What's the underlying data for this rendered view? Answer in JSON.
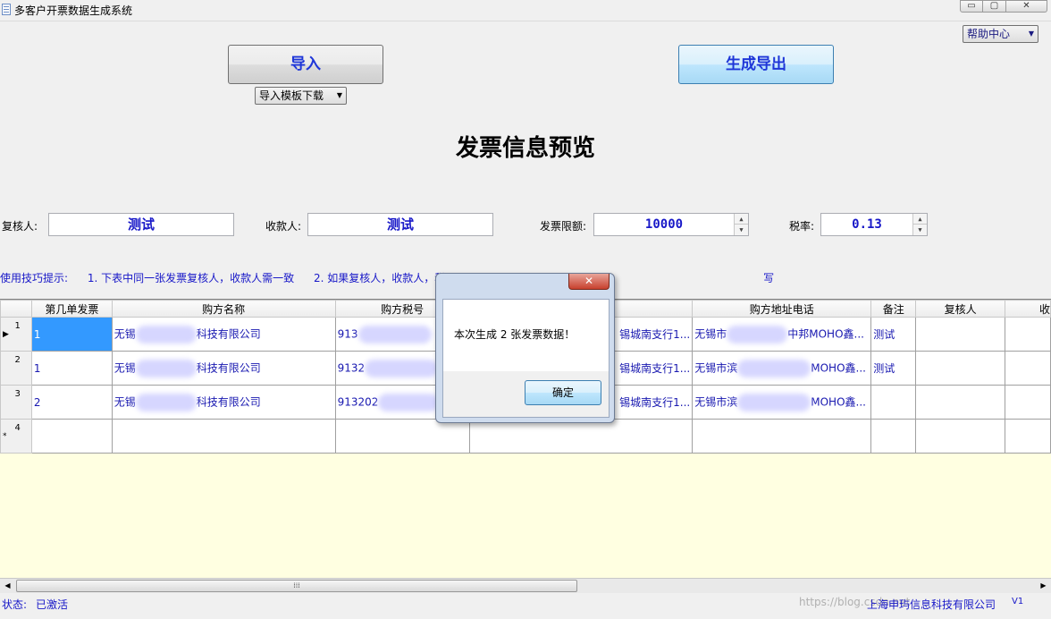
{
  "window": {
    "title": "多客户开票数据生成系统",
    "controls": {
      "minimize": "▭",
      "maximize": "▢",
      "close": "✕"
    }
  },
  "toolbar": {
    "import_label": "导入",
    "export_label": "生成导出",
    "template_dropdown": "导入模板下载",
    "help_dropdown": "帮助中心"
  },
  "preview_title": "发票信息预览",
  "fields": {
    "reviewer": {
      "label": "复核人:",
      "value": "测试"
    },
    "payee": {
      "label": "收款人:",
      "value": "测试"
    },
    "invoice_limit": {
      "label": "发票限额:",
      "value": "10000"
    },
    "tax_rate": {
      "label": "税率:",
      "value": "0.13"
    }
  },
  "tips": {
    "prefix": "使用技巧提示:",
    "tip1": "1. 下表中同一张发票复核人，收款人需一致",
    "tip2_start": "2. 如果复核人，收款人，税",
    "tip2_end": "写"
  },
  "grid": {
    "columns": [
      "第几单发票",
      "购方名称",
      "购方税号",
      "",
      "购方地址电话",
      "备注",
      "复核人",
      "收"
    ],
    "rows": [
      {
        "num": "1",
        "marker": "▶",
        "invoice_no": "1",
        "name_start": "无锡",
        "name_end": "科技有限公司",
        "tax_id": "913",
        "bank": "锡城南支行1...",
        "addr_start": "无锡市",
        "addr_end": "中邦MOHO鑫...",
        "note": "测试"
      },
      {
        "num": "2",
        "marker": "",
        "invoice_no": "1",
        "name_start": "无锡",
        "name_end": "科技有限公司",
        "tax_id": "9132",
        "bank": "锡城南支行1...",
        "addr_start": "无锡市滨",
        "addr_end": "MOHO鑫...",
        "note": "测试"
      },
      {
        "num": "3",
        "marker": "",
        "invoice_no": "2",
        "name_start": "无锡",
        "name_end": "科技有限公司",
        "tax_id": "913202",
        "bank": "锡城南支行1...",
        "addr_start": "无锡市滨",
        "addr_end": "MOHO鑫...",
        "note": ""
      },
      {
        "num": "4",
        "marker": "*",
        "invoice_no": "",
        "name_start": "",
        "name_end": "",
        "tax_id": "",
        "bank": "",
        "addr_start": "",
        "addr_end": "",
        "note": ""
      }
    ]
  },
  "status": {
    "label": "状态:",
    "value": "已激活",
    "company": "上海申玙信息科技有限公司",
    "version": "V1",
    "watermark": "https://blog.csdn.net"
  },
  "dialog": {
    "message": "本次生成 2 张发票数据！",
    "ok_label": "确定",
    "close_label": "✕"
  }
}
